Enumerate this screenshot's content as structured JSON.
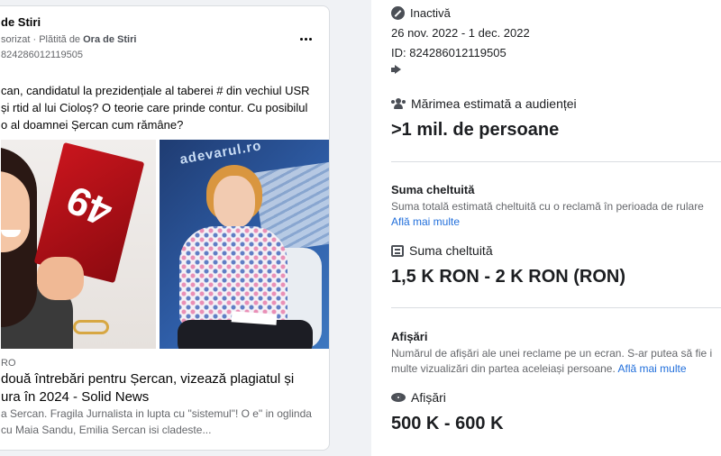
{
  "ad": {
    "page_name": "de Stiri",
    "sponsored_label": "sorizat",
    "paid_by_prefix": "Plătită de",
    "paid_by_name": "Ora de Stiri",
    "library_id": "824286012119505",
    "body_text": "can, candidatul la prezidențiale al taberei # din vechiul USR și rtid al lui Cioloș? O teorie care prinde contur. Cu posibilul o al doamnei Șercan cum rămâne?",
    "image_left_number": "49",
    "image_right_watermark": "adevarul.ro",
    "link_domain": "RO",
    "link_title": "două întrebări pentru Șercan, vizează plagiatul și ura în 2024 - Solid News",
    "link_description": "a Sercan. Fragila Jurnalista in lupta cu \"sistemul\"! O e\" in oglinda cu Maia Sandu, Emilia Sercan isi cladeste..."
  },
  "details": {
    "status": "Inactivă",
    "date_range": "26 nov. 2022 - 1 dec. 2022",
    "id_label": "ID: 824286012119505",
    "audience_heading": "Mărimea estimată a audienței",
    "audience_value": ">1 mil. de persoane",
    "spend_title": "Suma cheltuită",
    "spend_desc": "Suma totală estimată cheltuită cu o reclamă în perioada de rulare",
    "spend_link": "Află mai multe",
    "spend_heading": "Suma cheltuită",
    "spend_value": "1,5 K RON - 2 K RON (RON)",
    "impressions_title": "Afișări",
    "impressions_desc": "Numărul de afișări ale unei reclame pe un ecran. S-ar putea să fie i multe vizualizări din partea aceleiași persoane.",
    "impressions_link": "Află mai multe",
    "impressions_heading": "Afișări",
    "impressions_value": "500 K - 600 K"
  },
  "icons": {
    "status": "ban-icon",
    "media": "megaphone-icon",
    "audience": "people-icon",
    "spend": "money-icon",
    "impressions": "eye-icon",
    "menu": "more-icon"
  },
  "colors": {
    "link": "#216fdb",
    "muted": "#65676b",
    "text": "#1c1e21",
    "background": "#f0f2f5"
  }
}
